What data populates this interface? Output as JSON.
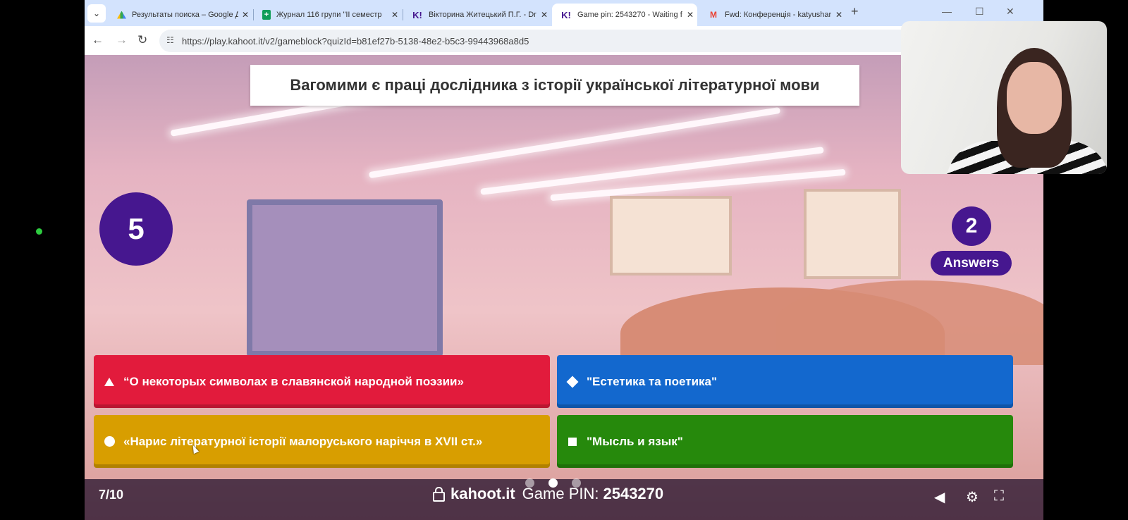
{
  "browser": {
    "tabs": [
      {
        "title": "Результаты поиска – Google Д",
        "icon": "google-drive-icon"
      },
      {
        "title": "Журнал 116 групи \"ІІ семестр",
        "icon": "google-sheets-icon"
      },
      {
        "title": "Вікторина Житецький П.Г. - Dr",
        "icon": "kahoot-icon"
      },
      {
        "title": "Game pin: 2543270 - Waiting f",
        "icon": "kahoot-icon",
        "active": true
      },
      {
        "title": "Fwd: Конференція - katyushar",
        "icon": "gmail-icon"
      }
    ],
    "url": "https://play.kahoot.it/v2/gameblock?quizId=b81ef27b-5138-48e2-b5c3-99443968a8d5"
  },
  "quiz": {
    "question": "Вагомими є праці дослідника з історії української літературної мови",
    "timer": "5",
    "answers_count": "2",
    "answers_label": "Answers",
    "options": [
      {
        "shape": "triangle",
        "color": "#e21b3c",
        "text": "“О некоторых символах в славянской народной поэзии»"
      },
      {
        "shape": "diamond",
        "color": "#1368ce",
        "text": "\"Естетика та поетика\""
      },
      {
        "shape": "circle",
        "color": "#d89e00",
        "text": "«Нарис літературної історії малоруського наріччя в XVII ст.»"
      },
      {
        "shape": "square",
        "color": "#26890c",
        "text": "\"Мысль и язык\""
      }
    ],
    "progress": "7/10",
    "brand": "kahoot.it",
    "pin_label": "Game PIN:",
    "pin": "2543270"
  },
  "icons": {
    "lock": "lock-icon",
    "volume": "volume-icon",
    "settings": "gear-icon",
    "fullscreen": "fullscreen-icon"
  }
}
